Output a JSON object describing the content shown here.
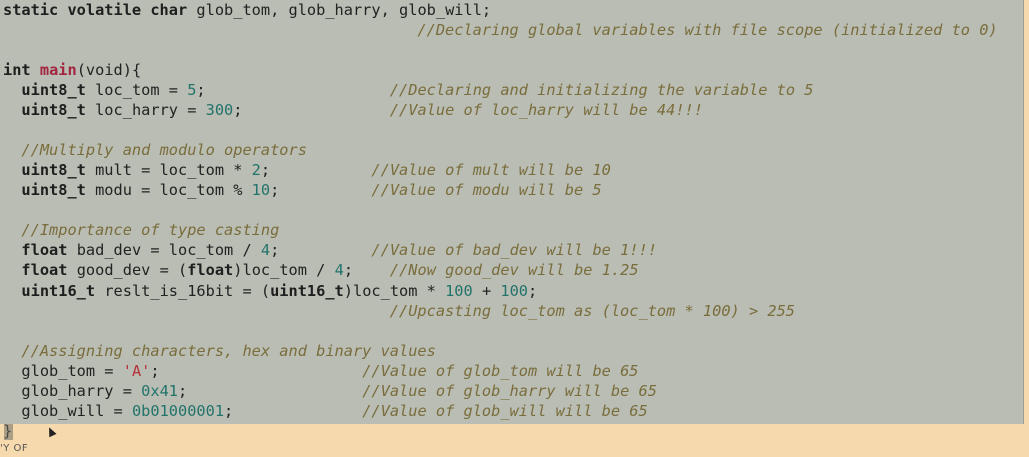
{
  "editor": {
    "lines": [
      [
        {
          "k": "kw",
          "t": "static volatile char"
        },
        {
          "k": "plain",
          "t": " glob_tom, glob_harry, glob_will;"
        }
      ],
      [
        {
          "k": "cmt",
          "t": "                                             //Declaring global variables with file scope (initialized to 0)"
        }
      ],
      [],
      [
        {
          "k": "kw",
          "t": "int"
        },
        {
          "k": "plain",
          "t": " "
        },
        {
          "k": "fn",
          "t": "main"
        },
        {
          "k": "plain",
          "t": "(void){"
        }
      ],
      [
        {
          "k": "plain",
          "t": "  "
        },
        {
          "k": "type",
          "t": "uint8_t"
        },
        {
          "k": "plain",
          "t": " loc_tom = "
        },
        {
          "k": "num",
          "t": "5"
        },
        {
          "k": "plain",
          "t": ";                    "
        },
        {
          "k": "cmt",
          "t": "//Declaring and initializing the variable to 5"
        }
      ],
      [
        {
          "k": "plain",
          "t": "  "
        },
        {
          "k": "type",
          "t": "uint8_t"
        },
        {
          "k": "plain",
          "t": " loc_harry = "
        },
        {
          "k": "num",
          "t": "300"
        },
        {
          "k": "plain",
          "t": ";                "
        },
        {
          "k": "cmt",
          "t": "//Value of loc_harry will be 44!!!"
        }
      ],
      [],
      [
        {
          "k": "plain",
          "t": "  "
        },
        {
          "k": "cmt",
          "t": "//Multiply and modulo operators"
        }
      ],
      [
        {
          "k": "plain",
          "t": "  "
        },
        {
          "k": "type",
          "t": "uint8_t"
        },
        {
          "k": "plain",
          "t": " mult = loc_tom * "
        },
        {
          "k": "num",
          "t": "2"
        },
        {
          "k": "plain",
          "t": ";           "
        },
        {
          "k": "cmt",
          "t": "//Value of mult will be 10"
        }
      ],
      [
        {
          "k": "plain",
          "t": "  "
        },
        {
          "k": "type",
          "t": "uint8_t"
        },
        {
          "k": "plain",
          "t": " modu = loc_tom % "
        },
        {
          "k": "num",
          "t": "10"
        },
        {
          "k": "plain",
          "t": ";          "
        },
        {
          "k": "cmt",
          "t": "//Value of modu will be 5"
        }
      ],
      [],
      [
        {
          "k": "plain",
          "t": "  "
        },
        {
          "k": "cmt",
          "t": "//Importance of type casting"
        }
      ],
      [
        {
          "k": "plain",
          "t": "  "
        },
        {
          "k": "type",
          "t": "float"
        },
        {
          "k": "plain",
          "t": " bad_dev = loc_tom / "
        },
        {
          "k": "num",
          "t": "4"
        },
        {
          "k": "plain",
          "t": ";          "
        },
        {
          "k": "cmt",
          "t": "//Value of bad_dev will be 1!!!"
        }
      ],
      [
        {
          "k": "plain",
          "t": "  "
        },
        {
          "k": "type",
          "t": "float"
        },
        {
          "k": "plain",
          "t": " good_dev = ("
        },
        {
          "k": "type",
          "t": "float"
        },
        {
          "k": "plain",
          "t": ")loc_tom / "
        },
        {
          "k": "num",
          "t": "4"
        },
        {
          "k": "plain",
          "t": ";    "
        },
        {
          "k": "cmt",
          "t": "//Now good_dev will be 1.25"
        }
      ],
      [
        {
          "k": "plain",
          "t": "  "
        },
        {
          "k": "type",
          "t": "uint16_t"
        },
        {
          "k": "plain",
          "t": " reslt_is_16bit = ("
        },
        {
          "k": "type",
          "t": "uint16_t"
        },
        {
          "k": "plain",
          "t": ")loc_tom * "
        },
        {
          "k": "num",
          "t": "100"
        },
        {
          "k": "plain",
          "t": " + "
        },
        {
          "k": "num",
          "t": "100"
        },
        {
          "k": "plain",
          "t": ";"
        }
      ],
      [
        {
          "k": "cmt",
          "t": "                                          //Upcasting loc_tom as (loc_tom * 100) > 255"
        }
      ],
      [],
      [
        {
          "k": "plain",
          "t": "  "
        },
        {
          "k": "cmt",
          "t": "//Assigning characters, hex and binary values"
        }
      ],
      [
        {
          "k": "plain",
          "t": "  glob_tom = "
        },
        {
          "k": "str",
          "t": "'A'"
        },
        {
          "k": "plain",
          "t": ";                      "
        },
        {
          "k": "cmt",
          "t": "//Value of glob_tom will be 65"
        }
      ],
      [
        {
          "k": "plain",
          "t": "  glob_harry = "
        },
        {
          "k": "num",
          "t": "0x41"
        },
        {
          "k": "plain",
          "t": ";                   "
        },
        {
          "k": "cmt",
          "t": "//Value of glob_harry will be 65"
        }
      ],
      [
        {
          "k": "plain",
          "t": "  glob_will = "
        },
        {
          "k": "num",
          "t": "0b01000001"
        },
        {
          "k": "plain",
          "t": ";              "
        },
        {
          "k": "cmt",
          "t": "//Value of glob_will will be 65"
        }
      ],
      [
        {
          "k": "plain",
          "t": "}"
        }
      ]
    ]
  },
  "corner_fragment": "'Y OF",
  "colors": {
    "editor_bg": "#b9bdb3",
    "page_bg": "#f7d9ae",
    "keyword": "#1e1e1e",
    "function": "#a3243e",
    "number": "#21736b",
    "string": "#b8323b",
    "comment": "#7a6d3c"
  }
}
